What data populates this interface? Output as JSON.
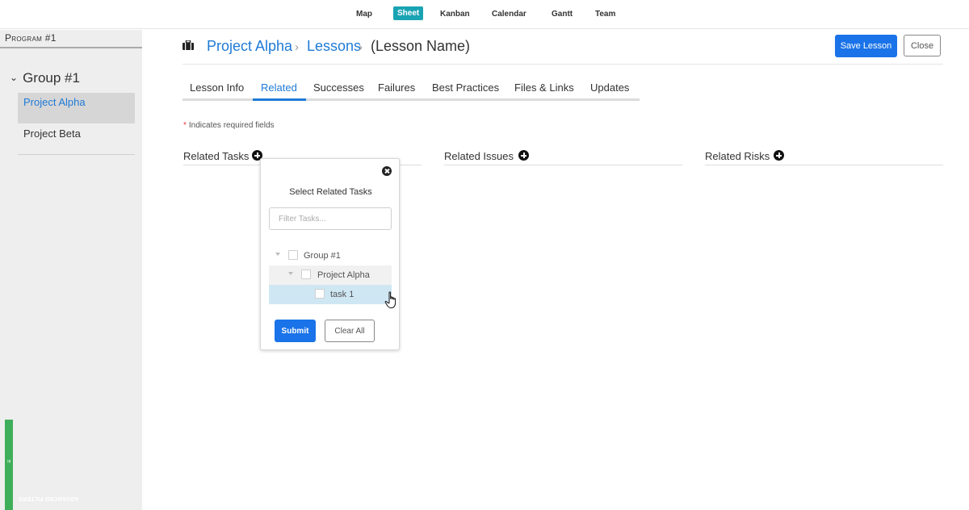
{
  "topnav": {
    "items": [
      {
        "label": "Map",
        "active": false
      },
      {
        "label": "Sheet",
        "active": true
      },
      {
        "label": "Kanban",
        "active": false
      },
      {
        "label": "Calendar",
        "active": false
      },
      {
        "label": "Gantt",
        "active": false
      },
      {
        "label": "Team",
        "active": false
      }
    ]
  },
  "sidebar": {
    "program": "Program #1",
    "group": "Group #1",
    "projects": [
      "Project Alpha",
      "Project Beta"
    ],
    "selected_project": "Project Alpha",
    "advanced_filters_label": "ADVANCED FILTERS"
  },
  "header": {
    "icon": "briefcase-icon",
    "breadcrumb": [
      "Project Alpha",
      "Lessons",
      "(Lesson Name)"
    ],
    "separator": "›",
    "save_label": "Save Lesson",
    "close_label": "Close"
  },
  "tabs": {
    "items": [
      "Lesson Info",
      "Related",
      "Successes",
      "Failures",
      "Best Practices",
      "Files & Links",
      "Updates"
    ],
    "active": "Related"
  },
  "required_note": {
    "star": "*",
    "text": "Indicates required fields"
  },
  "related": {
    "tasks_label": "Related Tasks",
    "issues_label": "Related Issues",
    "risks_label": "Related Risks"
  },
  "popup": {
    "title": "Select Related Tasks",
    "filter_placeholder": "Filter Tasks...",
    "tree": {
      "group": "Group #1",
      "project": "Project Alpha",
      "task": "task 1"
    },
    "submit_label": "Submit",
    "clear_label": "Clear All"
  },
  "colors": {
    "accent": "#1f7ad6",
    "primary_button": "#1a73e8",
    "active_nav": "#1aa3b3",
    "advanced_filters": "#3fae5a",
    "hover_row": "#cfe7f3"
  }
}
